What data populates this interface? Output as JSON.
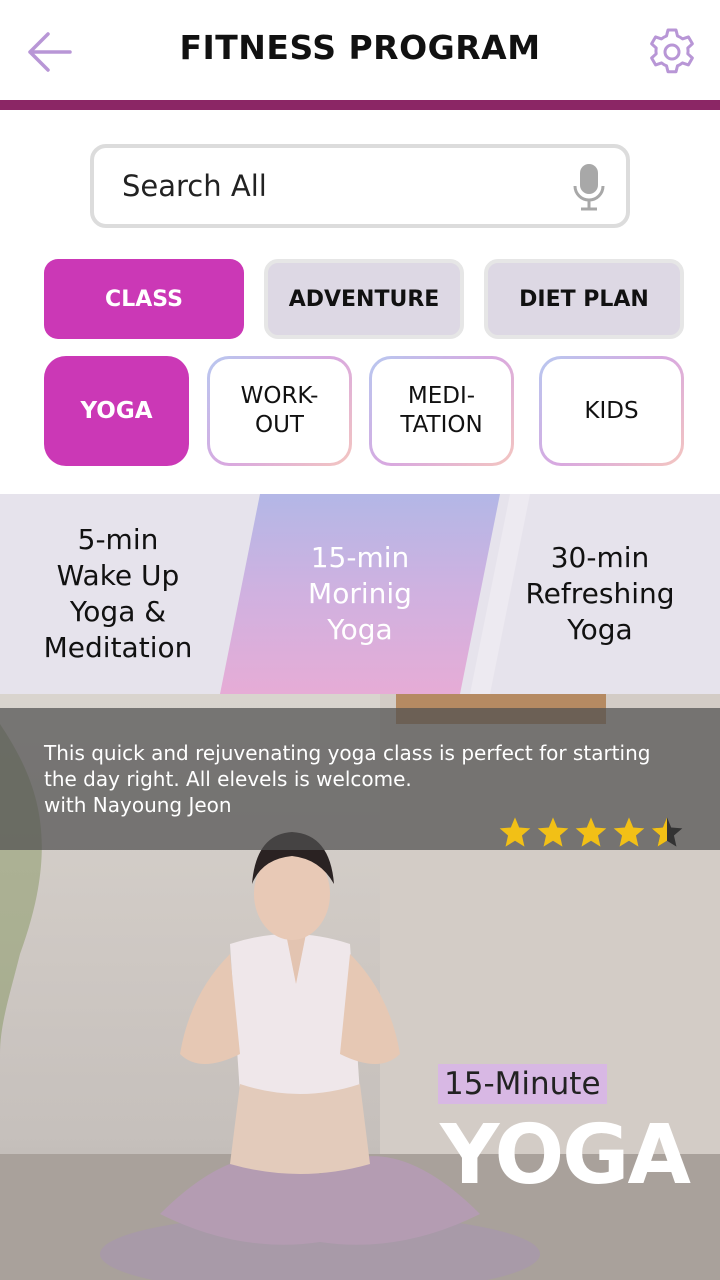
{
  "header": {
    "title": "FITNESS PROGRAM",
    "back_icon": "arrow-left-icon",
    "settings_icon": "gear-icon"
  },
  "search": {
    "placeholder": "Search All",
    "icon": "microphone-icon"
  },
  "categories": [
    {
      "label": "CLASS",
      "active": true
    },
    {
      "label": "ADVENTURE",
      "active": false
    },
    {
      "label": "DIET PLAN",
      "active": false
    }
  ],
  "subcategories": [
    {
      "label": "YOGA",
      "active": true
    },
    {
      "label": "WORK-\nOUT",
      "active": false
    },
    {
      "label": "MEDI-\nTATION",
      "active": false
    },
    {
      "label": "KIDS",
      "active": false
    }
  ],
  "sessions": [
    {
      "label": "5-min\nWake Up\nYoga &\nMeditation",
      "selected": false
    },
    {
      "label": "15-min\nMorinig\nYoga",
      "selected": true
    },
    {
      "label": "30-min\nRefreshing\nYoga",
      "selected": false
    }
  ],
  "hero": {
    "description": "This quick and rejuvenating yoga class is perfect for starting\nthe day right. All elevels is welcome.\nwith Nayoung Jeon",
    "rating": 4.5,
    "badge": "15-Minute",
    "title": "YOGA"
  },
  "colors": {
    "accent": "#cb38b6",
    "header_bar": "#8b2665",
    "star": "#f2c016"
  }
}
